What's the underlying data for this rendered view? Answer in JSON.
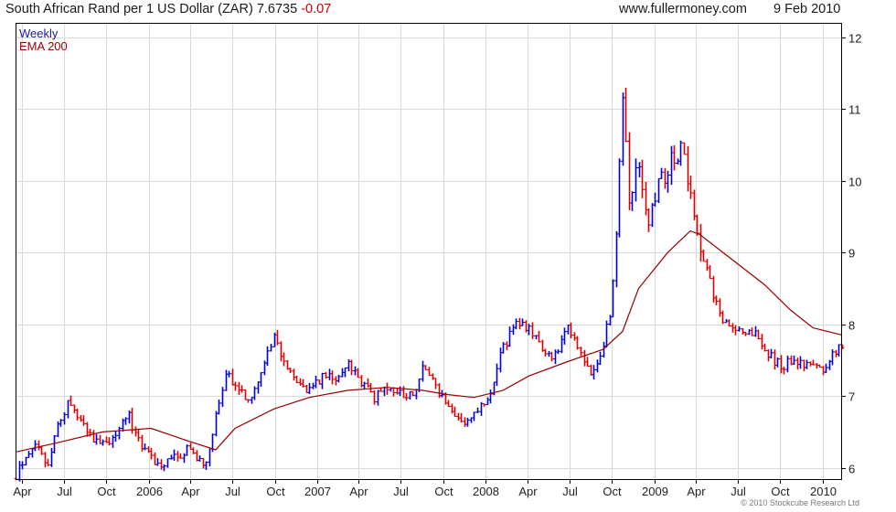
{
  "header": {
    "title": "South African Rand per 1 US Dollar (ZAR)",
    "last": "7.6735",
    "change": "-0.07",
    "site": "www.fullermoney.com",
    "date": "9 Feb 2010"
  },
  "footer": {
    "credit": "© 2010 Stockcube Research Ltd"
  },
  "colors": {
    "up": "#0000cc",
    "down": "#dd0000",
    "ema": "#990000",
    "grid": "#d9d9d9",
    "frame": "#000000"
  },
  "chart_data": {
    "type": "ohlc",
    "legend": [
      {
        "label": "Weekly",
        "color": "#1a1aa6"
      },
      {
        "label": "EMA 200",
        "color": "#990000"
      }
    ],
    "legend_position": "top-left",
    "ylim": [
      5.83,
      12.2
    ],
    "y_axis_side": "right",
    "yticks": [
      6,
      7,
      8,
      9,
      10,
      11,
      12
    ],
    "x_start": "2005-03-18",
    "x_end": "2010-02-12",
    "xticks": [
      {
        "label": "Apr",
        "date": "2005-04-01"
      },
      {
        "label": "Jul",
        "date": "2005-07-01"
      },
      {
        "label": "Oct",
        "date": "2005-10-01"
      },
      {
        "label": "2006",
        "date": "2006-01-01"
      },
      {
        "label": "Apr",
        "date": "2006-04-01"
      },
      {
        "label": "Jul",
        "date": "2006-07-01"
      },
      {
        "label": "Oct",
        "date": "2006-10-01"
      },
      {
        "label": "2007",
        "date": "2007-01-01"
      },
      {
        "label": "Apr",
        "date": "2007-04-01"
      },
      {
        "label": "Jul",
        "date": "2007-07-01"
      },
      {
        "label": "Oct",
        "date": "2007-10-01"
      },
      {
        "label": "2008",
        "date": "2008-01-01"
      },
      {
        "label": "Apr",
        "date": "2008-04-01"
      },
      {
        "label": "Jul",
        "date": "2008-07-01"
      },
      {
        "label": "Oct",
        "date": "2008-10-01"
      },
      {
        "label": "2009",
        "date": "2009-01-01"
      },
      {
        "label": "Apr",
        "date": "2009-04-01"
      },
      {
        "label": "Jul",
        "date": "2009-07-01"
      },
      {
        "label": "Oct",
        "date": "2009-10-01"
      },
      {
        "label": "2010",
        "date": "2010-01-01"
      }
    ],
    "close_path": [
      [
        "2005-03-18",
        5.85
      ],
      [
        "2005-04-08",
        6.2
      ],
      [
        "2005-05-06",
        6.3
      ],
      [
        "2005-05-27",
        6.05
      ],
      [
        "2005-06-17",
        6.55
      ],
      [
        "2005-07-08",
        6.9
      ],
      [
        "2005-07-29",
        6.75
      ],
      [
        "2005-08-26",
        6.45
      ],
      [
        "2005-09-23",
        6.3
      ],
      [
        "2005-10-21",
        6.5
      ],
      [
        "2005-11-18",
        6.7
      ],
      [
        "2005-12-09",
        6.4
      ],
      [
        "2006-01-06",
        6.15
      ],
      [
        "2006-01-27",
        6.05
      ],
      [
        "2006-02-24",
        6.12
      ],
      [
        "2006-03-24",
        6.25
      ],
      [
        "2006-04-14",
        6.1
      ],
      [
        "2006-05-05",
        6.05
      ],
      [
        "2006-05-26",
        6.7
      ],
      [
        "2006-06-16",
        7.35
      ],
      [
        "2006-07-07",
        7.1
      ],
      [
        "2006-08-04",
        6.95
      ],
      [
        "2006-09-01",
        7.3
      ],
      [
        "2006-09-29",
        7.85
      ],
      [
        "2006-10-20",
        7.5
      ],
      [
        "2006-11-17",
        7.25
      ],
      [
        "2006-12-15",
        7.05
      ],
      [
        "2007-01-12",
        7.3
      ],
      [
        "2007-02-09",
        7.2
      ],
      [
        "2007-03-09",
        7.45
      ],
      [
        "2007-04-06",
        7.2
      ],
      [
        "2007-05-04",
        6.95
      ],
      [
        "2007-06-01",
        7.15
      ],
      [
        "2007-06-29",
        7.05
      ],
      [
        "2007-07-27",
        7.0
      ],
      [
        "2007-08-17",
        7.45
      ],
      [
        "2007-09-14",
        7.1
      ],
      [
        "2007-10-12",
        6.8
      ],
      [
        "2007-11-09",
        6.65
      ],
      [
        "2007-12-07",
        6.75
      ],
      [
        "2008-01-04",
        6.9
      ],
      [
        "2008-02-08",
        7.7
      ],
      [
        "2008-03-14",
        8.05
      ],
      [
        "2008-04-04",
        7.95
      ],
      [
        "2008-05-02",
        7.6
      ],
      [
        "2008-05-30",
        7.55
      ],
      [
        "2008-06-27",
        7.95
      ],
      [
        "2008-07-25",
        7.65
      ],
      [
        "2008-08-15",
        7.25
      ],
      [
        "2008-09-12",
        7.75
      ],
      [
        "2008-09-26",
        8.15
      ],
      [
        "2008-10-10",
        9.2
      ],
      [
        "2008-10-24",
        11.2
      ],
      [
        "2008-11-07",
        9.8
      ],
      [
        "2008-11-28",
        10.2
      ],
      [
        "2008-12-19",
        9.45
      ],
      [
        "2009-01-09",
        9.9
      ],
      [
        "2009-01-30",
        10.2
      ],
      [
        "2009-02-27",
        10.45
      ],
      [
        "2009-03-20",
        9.8
      ],
      [
        "2009-04-10",
        9.1
      ],
      [
        "2009-05-01",
        8.6
      ],
      [
        "2009-05-22",
        8.1
      ],
      [
        "2009-06-19",
        7.95
      ],
      [
        "2009-07-10",
        7.95
      ],
      [
        "2009-08-07",
        7.85
      ],
      [
        "2009-09-04",
        7.6
      ],
      [
        "2009-10-02",
        7.4
      ],
      [
        "2009-10-23",
        7.5
      ],
      [
        "2009-11-13",
        7.45
      ],
      [
        "2009-12-11",
        7.45
      ],
      [
        "2010-01-08",
        7.35
      ],
      [
        "2010-01-22",
        7.55
      ],
      [
        "2010-02-05",
        7.75
      ],
      [
        "2010-02-12",
        7.67
      ]
    ],
    "ema_path": [
      [
        "2005-03-18",
        6.22
      ],
      [
        "2005-06-17",
        6.35
      ],
      [
        "2005-09-23",
        6.5
      ],
      [
        "2006-01-06",
        6.55
      ],
      [
        "2006-03-24",
        6.38
      ],
      [
        "2006-05-26",
        6.25
      ],
      [
        "2006-07-07",
        6.55
      ],
      [
        "2006-09-29",
        6.82
      ],
      [
        "2006-12-15",
        6.98
      ],
      [
        "2007-03-09",
        7.08
      ],
      [
        "2007-06-01",
        7.12
      ],
      [
        "2007-08-17",
        7.08
      ],
      [
        "2007-10-12",
        7.02
      ],
      [
        "2007-12-07",
        6.98
      ],
      [
        "2008-02-08",
        7.08
      ],
      [
        "2008-04-04",
        7.28
      ],
      [
        "2008-06-27",
        7.48
      ],
      [
        "2008-09-12",
        7.65
      ],
      [
        "2008-10-24",
        7.9
      ],
      [
        "2008-11-28",
        8.5
      ],
      [
        "2009-01-30",
        9.0
      ],
      [
        "2009-03-20",
        9.3
      ],
      [
        "2009-04-10",
        9.25
      ],
      [
        "2009-06-19",
        8.9
      ],
      [
        "2009-08-28",
        8.55
      ],
      [
        "2009-10-23",
        8.2
      ],
      [
        "2009-12-11",
        7.95
      ],
      [
        "2010-02-12",
        7.85
      ]
    ]
  }
}
